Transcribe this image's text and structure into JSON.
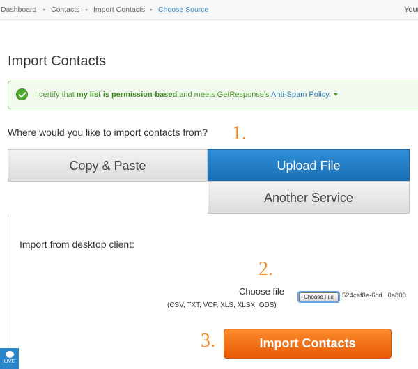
{
  "breadcrumb": {
    "items": [
      "Dashboard",
      "Contacts",
      "Import Contacts",
      "Choose Source"
    ],
    "user_label": "Your"
  },
  "page": {
    "title": "Import Contacts"
  },
  "certification": {
    "text_start": "I certify that ",
    "text_bold": "my list is permission-based",
    "text_middle": " and meets GetResponse's ",
    "link": "Anti-Spam Policy."
  },
  "source_question": "Where would you like to import contacts from?",
  "steps": [
    "1.",
    "2.",
    "3."
  ],
  "source_tabs": {
    "copy_paste": "Copy & Paste",
    "upload_file": "Upload File",
    "another_service": "Another Service",
    "selected": "Upload File"
  },
  "upload": {
    "desktop_label": "Import from desktop client:",
    "choose_label": "Choose file",
    "formats": "(CSV, TXT, VCF, XLS, XLSX, ODS)",
    "file_button": "Choose File",
    "file_name": "524caf8e-6cd...0a800"
  },
  "import_button": "Import Contacts",
  "live_badge": "LIVE",
  "colors": {
    "accent_blue": "#1a6fb4",
    "orange": "#f08a24",
    "green": "#4a9a2c"
  }
}
